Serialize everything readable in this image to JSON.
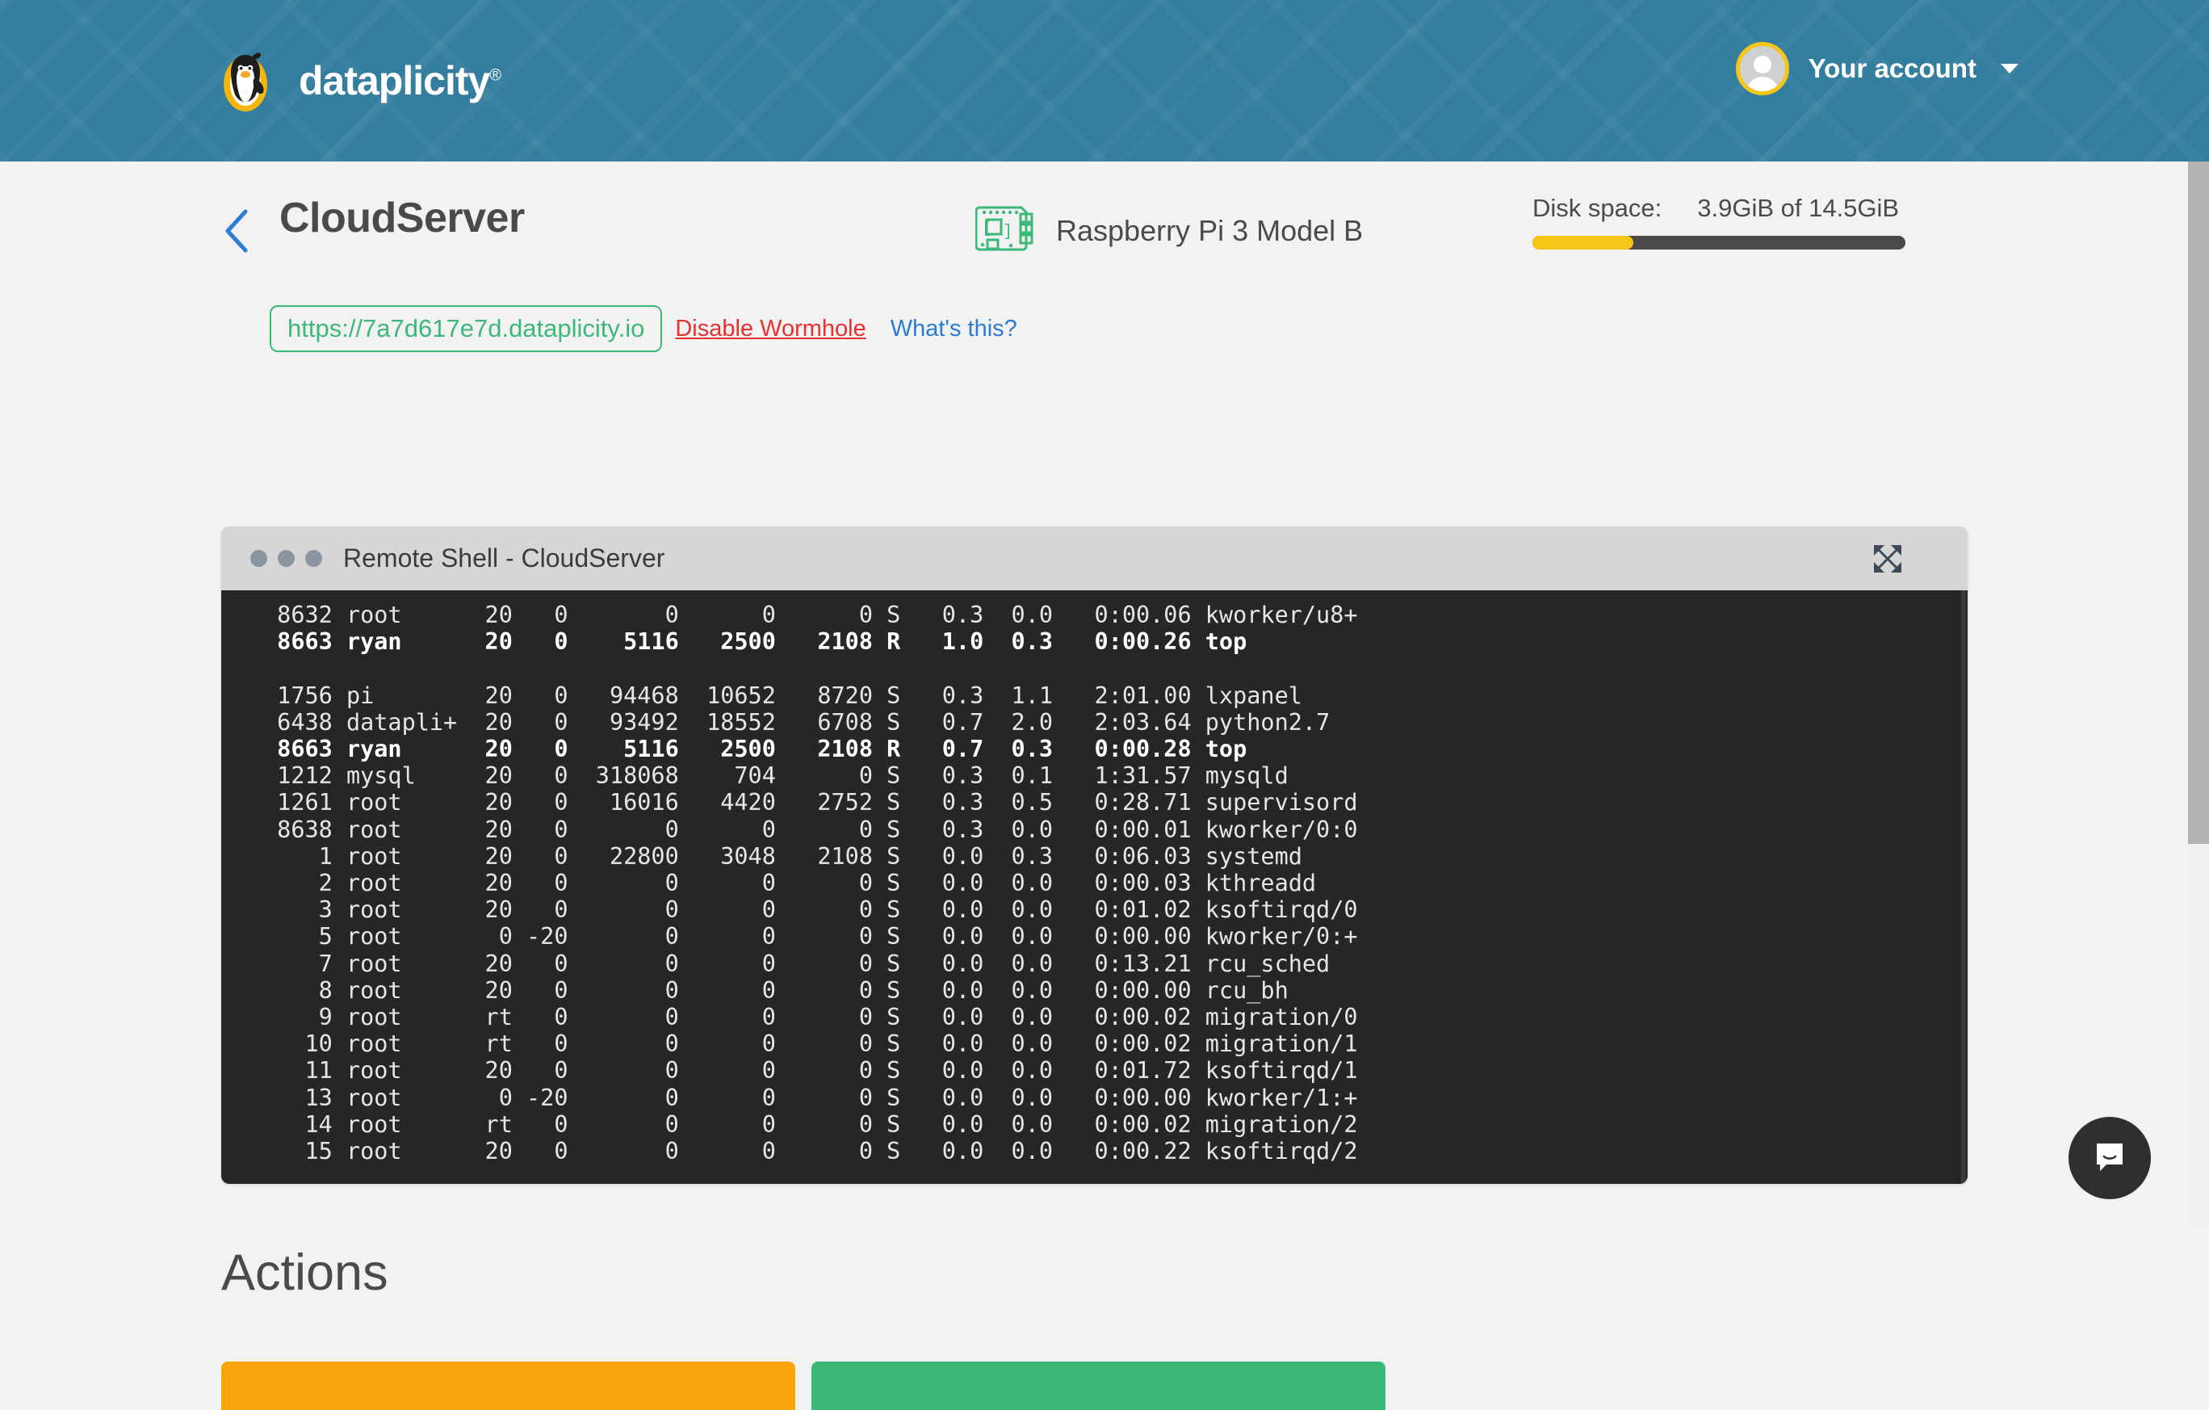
{
  "header": {
    "brand_name": "dataplicity",
    "brand_mark": "®",
    "logo_icon": "penguin-logo-icon",
    "account_label": "Your account",
    "avatar_icon": "user-avatar-icon",
    "caret_icon": "chevron-down-icon",
    "background_color": "#337d9e"
  },
  "device_page": {
    "back_icon": "chevron-left-icon",
    "title": "CloudServer",
    "device_icon": "raspberry-pi-board-icon",
    "device_name": "Raspberry Pi 3 Model B",
    "disk": {
      "label": "Disk space:",
      "value": "3.9GiB of 14.5GiB",
      "used_gib": 3.9,
      "total_gib": 14.5,
      "percent": 27,
      "fill_color": "#f5c518",
      "track_color": "#4a4a4a"
    },
    "wormhole": {
      "url": "https://7a7d617e7d.dataplicity.io",
      "url_color": "#3cb878",
      "disable_label": "Disable Wormhole",
      "disable_color": "#e8312f",
      "help_label": "What's this?",
      "help_color": "#2b7cd3"
    }
  },
  "terminal": {
    "title": "Remote Shell - CloudServer",
    "expand_icon": "expand-arrows-icon",
    "traffic_lights": [
      "dot",
      "dot",
      "dot"
    ],
    "background_color": "#262626",
    "lines": [
      {
        "text": " 8632 root      20   0       0      0      0 S   0.3  0.0   0:00.06 kworker/u8+",
        "bold": false
      },
      {
        "text": " 8663 ryan      20   0    5116   2500   2108 R   1.0  0.3   0:00.26 top",
        "bold": true
      },
      {
        "text": "",
        "bold": false
      },
      {
        "text": " 1756 pi        20   0   94468  10652   8720 S   0.3  1.1   2:01.00 lxpanel",
        "bold": false
      },
      {
        "text": " 6438 datapli+  20   0   93492  18552   6708 S   0.7  2.0   2:03.64 python2.7",
        "bold": false
      },
      {
        "text": " 8663 ryan      20   0    5116   2500   2108 R   0.7  0.3   0:00.28 top",
        "bold": true
      },
      {
        "text": " 1212 mysql     20   0  318068    704      0 S   0.3  0.1   1:31.57 mysqld",
        "bold": false
      },
      {
        "text": " 1261 root      20   0   16016   4420   2752 S   0.3  0.5   0:28.71 supervisord",
        "bold": false
      },
      {
        "text": " 8638 root      20   0       0      0      0 S   0.3  0.0   0:00.01 kworker/0:0",
        "bold": false
      },
      {
        "text": "    1 root      20   0   22800   3048   2108 S   0.0  0.3   0:06.03 systemd",
        "bold": false
      },
      {
        "text": "    2 root      20   0       0      0      0 S   0.0  0.0   0:00.03 kthreadd",
        "bold": false
      },
      {
        "text": "    3 root      20   0       0      0      0 S   0.0  0.0   0:01.02 ksoftirqd/0",
        "bold": false
      },
      {
        "text": "    5 root       0 -20       0      0      0 S   0.0  0.0   0:00.00 kworker/0:+",
        "bold": false
      },
      {
        "text": "    7 root      20   0       0      0      0 S   0.0  0.0   0:13.21 rcu_sched",
        "bold": false
      },
      {
        "text": "    8 root      20   0       0      0      0 S   0.0  0.0   0:00.00 rcu_bh",
        "bold": false
      },
      {
        "text": "    9 root      rt   0       0      0      0 S   0.0  0.0   0:00.02 migration/0",
        "bold": false
      },
      {
        "text": "   10 root      rt   0       0      0      0 S   0.0  0.0   0:00.02 migration/1",
        "bold": false
      },
      {
        "text": "   11 root      20   0       0      0      0 S   0.0  0.0   0:01.72 ksoftirqd/1",
        "bold": false
      },
      {
        "text": "   13 root       0 -20       0      0      0 S   0.0  0.0   0:00.00 kworker/1:+",
        "bold": false
      },
      {
        "text": "   14 root      rt   0       0      0      0 S   0.0  0.0   0:00.02 migration/2",
        "bold": false
      },
      {
        "text": "   15 root      20   0       0      0      0 S   0.0  0.0   0:00.22 ksoftirqd/2",
        "bold": false
      }
    ]
  },
  "actions": {
    "heading": "Actions",
    "buttons": [
      {
        "name": "action-button-primary",
        "color": "#f9a50b"
      },
      {
        "name": "action-button-secondary",
        "color": "#3cb878"
      }
    ]
  },
  "chat": {
    "icon": "chat-bubble-icon",
    "background_color": "#2f2f2f"
  }
}
